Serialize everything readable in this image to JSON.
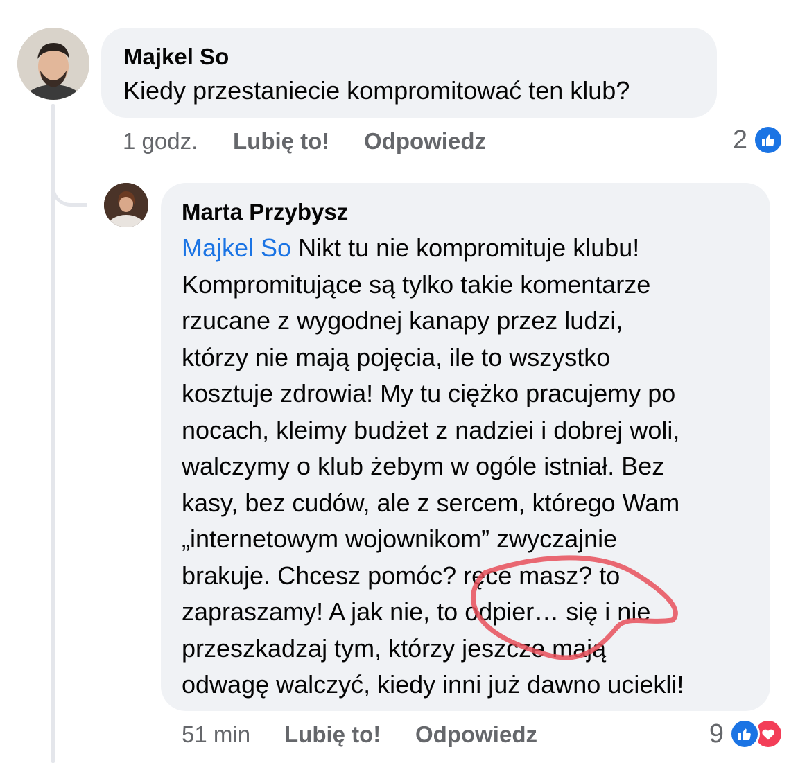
{
  "comments": [
    {
      "author": "Majkel So",
      "text": "Kiedy przestaniecie kompromitować ten klub?",
      "time": "1 godz.",
      "like_label": "Lubię to!",
      "reply_label": "Odpowiedz",
      "reaction_count": "2",
      "reactions": [
        "like-icon"
      ]
    },
    {
      "author": "Marta Przybysz",
      "mention": "Majkel So",
      "lines": [
        " Nikt tu nie kompromituje klubu!",
        "Kompromitujące są tylko takie komentarze",
        "rzucane z wygodnej kanapy przez ludzi,",
        "którzy nie mają pojęcia, ile to wszystko",
        "kosztuje zdrowia! My tu ciężko pracujemy po",
        "nocach, kleimy budżet z nadziei i dobrej woli,",
        "walczymy o klub żebym w ogóle istniał. Bez",
        "kasy, bez cudów, ale z sercem, którego Wam",
        "„internetowym wojownikom” zwyczajnie",
        "brakuje. Chcesz pomóc? ręce masz? to",
        "zapraszamy! A jak nie, to odpier… się i nie",
        "przeszkadzaj tym, którzy jeszcze mają",
        "odwagę walczyć, kiedy inni już dawno uciekli!"
      ],
      "time": "51 min",
      "like_label": "Lubię to!",
      "reply_label": "Odpowiedz",
      "reaction_count": "9",
      "reactions": [
        "like-icon",
        "love-icon"
      ]
    }
  ],
  "colors": {
    "bubble": "#f0f2f5",
    "mention": "#1b74e4",
    "meta": "#65676b",
    "like": "#1b74e4",
    "love": "#f33e58",
    "annotation": "#e8505b"
  }
}
